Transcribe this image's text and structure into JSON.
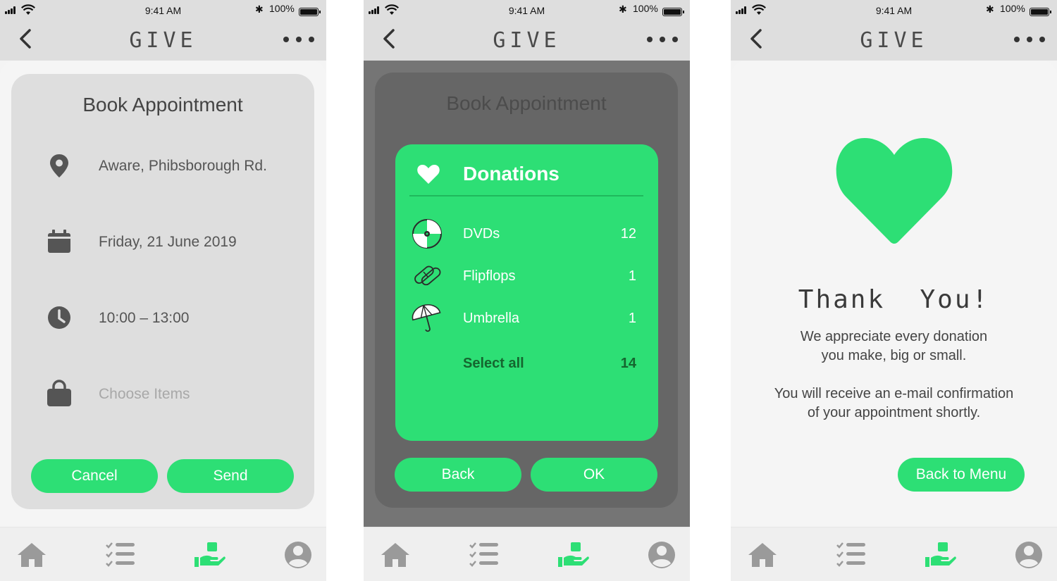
{
  "status": {
    "time": "9:41 AM",
    "battery": "100%",
    "bluetooth": "✱"
  },
  "nav": {
    "title": "GIVE"
  },
  "booking": {
    "title": "Book Appointment",
    "location": "Aware, Phibsborough Rd.",
    "date": "Friday, 21 June 2019",
    "time": "10:00 – 13:00",
    "items_placeholder": "Choose Items",
    "cancel": "Cancel",
    "send": "Send"
  },
  "donations": {
    "background_title": "Book Appointment",
    "title": "Donations",
    "items": [
      {
        "label": "DVDs",
        "count": "12",
        "icon": "disc-icon"
      },
      {
        "label": "Flipflops",
        "count": "1",
        "icon": "flipflops-icon"
      },
      {
        "label": "Umbrella",
        "count": "1",
        "icon": "umbrella-icon"
      }
    ],
    "select_all": {
      "label": "Select all",
      "count": "14"
    },
    "back": "Back",
    "ok": "OK"
  },
  "thankyou": {
    "title": "Thank  You!",
    "line1": "We appreciate every donation",
    "line2": "you make, big or small.",
    "line3": "You will receive an e-mail confirmation",
    "line4": "of your appointment shortly.",
    "button": "Back to Menu"
  },
  "tabs": [
    "home-icon",
    "checklist-icon",
    "give-hand-icon",
    "profile-icon"
  ],
  "colors": {
    "accent": "#2ddf75",
    "inactive_icon": "#9a9a9a",
    "topbar": "#dedede"
  }
}
